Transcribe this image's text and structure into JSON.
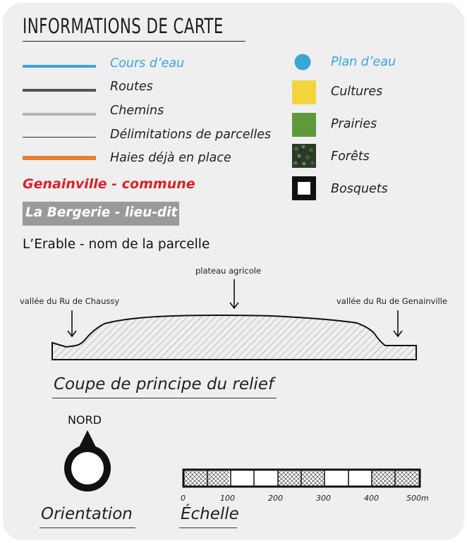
{
  "title": "INFORMATIONS DE CARTE",
  "legend_lines": [
    {
      "label": "Cours d’eau",
      "color": "#3ba5d8",
      "label_color": "#3ba5d8"
    },
    {
      "label": "Routes",
      "color": "#555555",
      "label_color": "#222222"
    },
    {
      "label": "Chemins",
      "color": "#b5b5b5",
      "label_color": "#222222"
    },
    {
      "label": "Délimitations de parcelles",
      "color": "#333333",
      "label_color": "#222222"
    },
    {
      "label": "Haies déjà en place",
      "color": "#e87f33",
      "label_color": "#222222"
    }
  ],
  "legend_areas": [
    {
      "label": "Plan d’eau",
      "color": "#3ba5d8"
    },
    {
      "label": "Cultures",
      "color": "#f2d43c"
    },
    {
      "label": "Prairies",
      "color": "#5e9a3c"
    },
    {
      "label": "Forêts",
      "color": "#2c3a28"
    },
    {
      "label": "Bosquets",
      "color": "#111111"
    }
  ],
  "naming": {
    "commune": "Genainville - commune",
    "lieu_dit": "La Bergerie - lieu-dit",
    "parcelle": "L’Erable - nom de la parcelle"
  },
  "relief": {
    "annotations": {
      "plateau": "plateau agricole",
      "left": "vallée du Ru de Chaussy",
      "right": "vallée du Ru de Genainville"
    },
    "title": "Coupe de principe du relief"
  },
  "orientation": {
    "north_label": "NORD",
    "title": "Orientation"
  },
  "scale": {
    "title": "Échelle",
    "ticks": [
      "0",
      "100",
      "200",
      "300",
      "400",
      "500m"
    ]
  }
}
